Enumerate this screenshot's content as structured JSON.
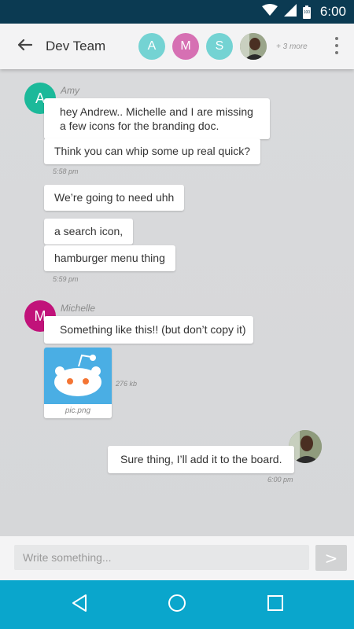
{
  "status_bar": {
    "time": "6:00",
    "battery_level": "100",
    "icons": [
      "wifi-icon",
      "signal-icon",
      "battery-icon"
    ]
  },
  "header": {
    "title": "Dev Team",
    "members": [
      {
        "initial": "A",
        "color": "#74d3d3"
      },
      {
        "initial": "M",
        "color": "#d670b3"
      },
      {
        "initial": "S",
        "color": "#74d3d3"
      }
    ],
    "more_members": "+ 3 more"
  },
  "messages": {
    "amy": {
      "name": "Amy",
      "initial": "A",
      "color": "#1cb99a",
      "texts": [
        "hey Andrew.. Michelle and I are missing",
        "a few icons for the branding doc.",
        "Think you can whip some up real quick?",
        "We’re going to need uhh",
        "a search icon,",
        "hamburger menu thing"
      ],
      "time_1": "5:58 pm",
      "time_2": "5:59 pm"
    },
    "michelle": {
      "name": "Michelle",
      "initial": "M",
      "color": "#c1127a",
      "text": "Something like this!! (but don’t copy it)",
      "attachment": {
        "file_name": "pic.png",
        "file_size": "276 kb"
      }
    },
    "me": {
      "text": "Sure thing, I’ll add it to the board.",
      "time": "6:00 pm"
    }
  },
  "composer": {
    "placeholder": "Write something...",
    "send_label": ">"
  },
  "colors": {
    "status_bar": "#0b3a52",
    "nav_bar": "#0aa6cc",
    "chat_background": "#d9dadc"
  }
}
